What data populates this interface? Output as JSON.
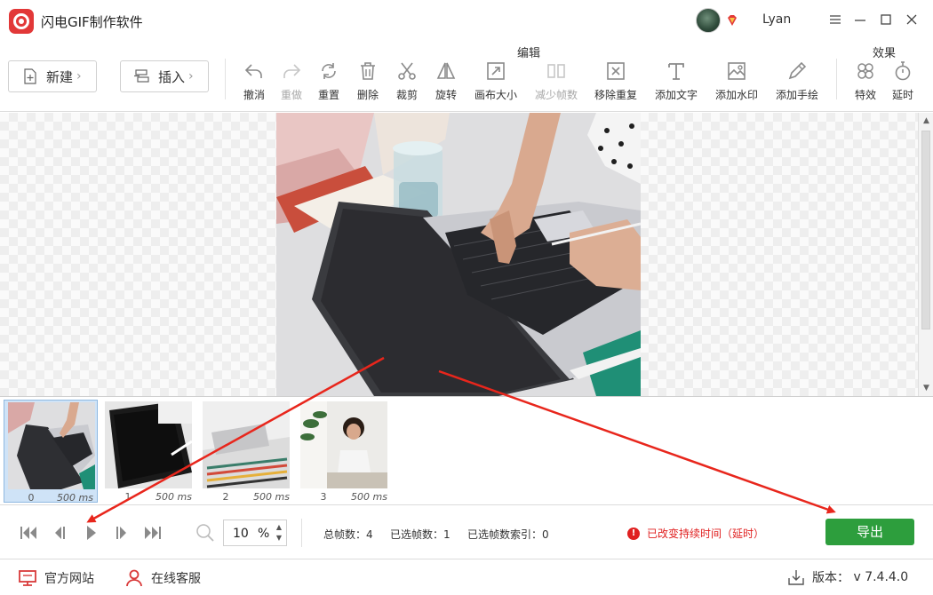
{
  "app": {
    "title": "闪电GIF制作软件",
    "user": "Lyan"
  },
  "colors": {
    "brand": "#e23838",
    "export": "#2d9e3d",
    "warning": "#e02020",
    "selection": "#cfe3f7"
  },
  "toolbar": {
    "new_label": "新建",
    "insert_label": "插入",
    "edit_group": "编辑",
    "effects_group": "效果",
    "tools": [
      {
        "label": "撤消",
        "icon": "undo-icon",
        "enabled": true
      },
      {
        "label": "重做",
        "icon": "redo-icon",
        "enabled": false
      },
      {
        "label": "重置",
        "icon": "reset-icon",
        "enabled": true
      },
      {
        "label": "删除",
        "icon": "delete-icon",
        "enabled": true
      },
      {
        "label": "裁剪",
        "icon": "crop-icon",
        "enabled": true
      },
      {
        "label": "旋转",
        "icon": "rotate-icon",
        "enabled": true
      },
      {
        "label": "画布大小",
        "icon": "canvas-size-icon",
        "enabled": true
      },
      {
        "label": "减少帧数",
        "icon": "reduce-frames-icon",
        "enabled": false
      },
      {
        "label": "移除重复",
        "icon": "remove-duplicate-icon",
        "enabled": true
      },
      {
        "label": "添加文字",
        "icon": "add-text-icon",
        "enabled": true
      },
      {
        "label": "添加水印",
        "icon": "add-watermark-icon",
        "enabled": true
      },
      {
        "label": "添加手绘",
        "icon": "add-drawing-icon",
        "enabled": true
      }
    ],
    "effects": [
      {
        "label": "特效",
        "icon": "effects-icon",
        "enabled": true
      },
      {
        "label": "延时",
        "icon": "delay-icon",
        "enabled": true
      }
    ]
  },
  "frames": [
    {
      "index": "0",
      "duration": "500 ms",
      "selected": true
    },
    {
      "index": "1",
      "duration": "500 ms",
      "selected": false
    },
    {
      "index": "2",
      "duration": "500 ms",
      "selected": false
    },
    {
      "index": "3",
      "duration": "500 ms",
      "selected": false
    }
  ],
  "playback": {
    "zoom_value": "10",
    "zoom_unit": "%",
    "total_frames_label": "总帧数：",
    "total_frames": "4",
    "selected_frames_label": "已选帧数：",
    "selected_frames": "1",
    "selected_index_label": "已选帧数索引：",
    "selected_index": "0",
    "warning": "已改变持续时间（延时）",
    "export_label": "导出"
  },
  "footer": {
    "website": "官方网站",
    "support": "在线客服",
    "version_label": "版本：",
    "version": "v 7.4.4.0"
  }
}
